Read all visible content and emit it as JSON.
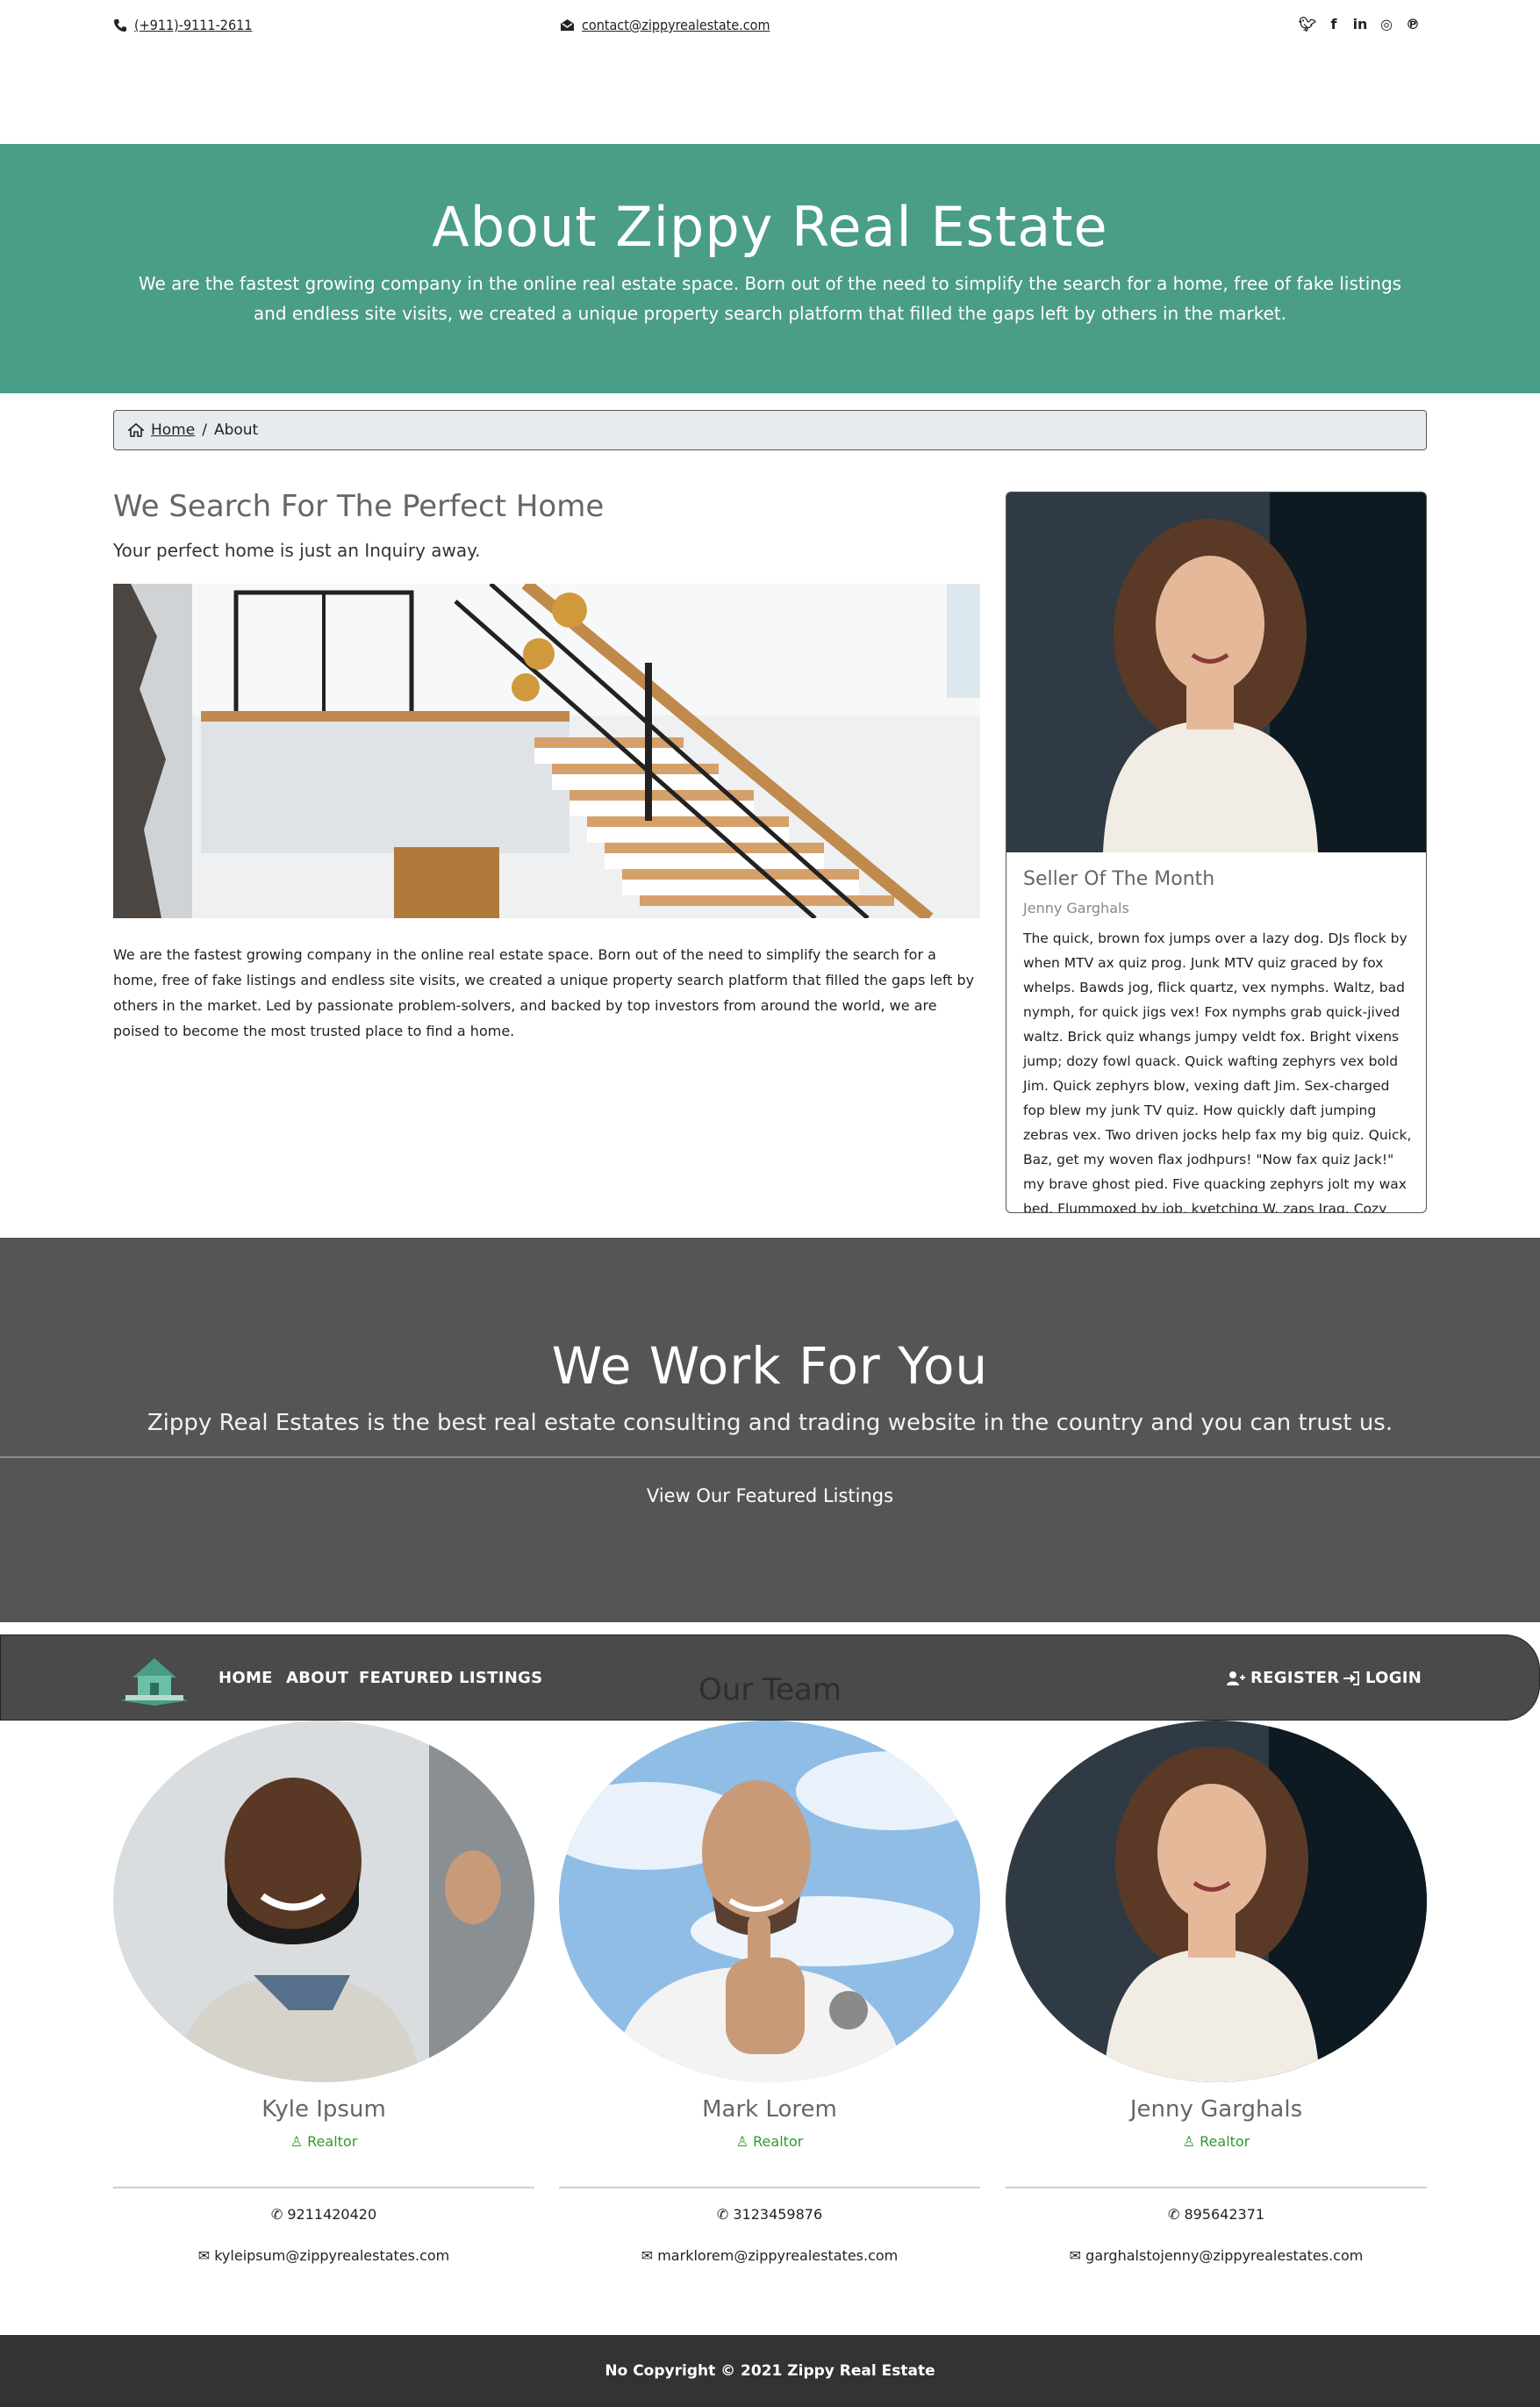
{
  "topbar": {
    "phone": "(+911)-9111-2611",
    "email": "contact@zippyrealestate.com",
    "social": [
      "twitter-icon",
      "facebook-icon",
      "linkedin-icon",
      "instagram-icon",
      "pinterest-icon"
    ]
  },
  "hero": {
    "title": "About Zippy Real Estate",
    "text": "We are the fastest growing company in the online real estate space. Born out of the need to simplify the search for a home, free of fake listings and endless site visits, we created a unique property search platform that filled the gaps left by others in the market."
  },
  "breadcrumb": {
    "home": "Home",
    "separator": "/",
    "current": "About"
  },
  "main": {
    "heading": "We Search For The Perfect Home",
    "subheading": "Your perfect home is just an Inquiry away.",
    "body": "We are the fastest growing company in the online real estate space. Born out of the need to simplify the search for a home, free of fake listings and endless site visits, we created a unique property search platform that filled the gaps left by others in the market. Led by passionate problem-solvers, and backed by top investors from around the world, we are poised to become the most trusted place to find a home."
  },
  "seller": {
    "title": "Seller Of The Month",
    "name": "Jenny Garghals",
    "description": "The quick, brown fox jumps over a lazy dog. DJs flock by when MTV ax quiz prog. Junk MTV quiz graced by fox whelps. Bawds jog, flick quartz, vex nymphs. Waltz, bad nymph, for quick jigs vex! Fox nymphs grab quick-jived waltz. Brick quiz whangs jumpy veldt fox. Bright vixens jump; dozy fowl quack. Quick wafting zephyrs vex bold Jim. Quick zephyrs blow, vexing daft Jim. Sex-charged fop blew my junk TV quiz. How quickly daft jumping zebras vex. Two driven jocks help fax my big quiz. Quick, Baz, get my woven flax jodhpurs! \"Now fax quiz Jack!\" my brave ghost pied. Five quacking zephyrs jolt my wax bed. Flummoxed by job, kvetching W. zaps Iraq. Cozy sphinx waves quart jug of bad milk."
  },
  "work": {
    "title": "We Work For You",
    "text": "Zippy Real Estates is the best real estate consulting and trading website in the country and you can trust us.",
    "button": "View Our Featured Listings"
  },
  "nav": {
    "links": [
      "HOME",
      "ABOUT",
      "FEATURED LISTINGS"
    ],
    "register": "REGISTER",
    "login": "LOGIN"
  },
  "team": {
    "title": "Our Team",
    "members": [
      {
        "name": "Kyle Ipsum",
        "role": "Realtor",
        "phone": "9211420420",
        "email": "kyleipsum@zippyrealestates.com"
      },
      {
        "name": "Mark Lorem",
        "role": "Realtor",
        "phone": "3123459876",
        "email": "marklorem@zippyrealestates.com"
      },
      {
        "name": "Jenny Garghals",
        "role": "Realtor",
        "phone": "895642371",
        "email": "garghalstojenny@zippyrealestates.com"
      }
    ]
  },
  "footer": {
    "text": "No Copyright © 2021 Zippy Real Estate"
  }
}
